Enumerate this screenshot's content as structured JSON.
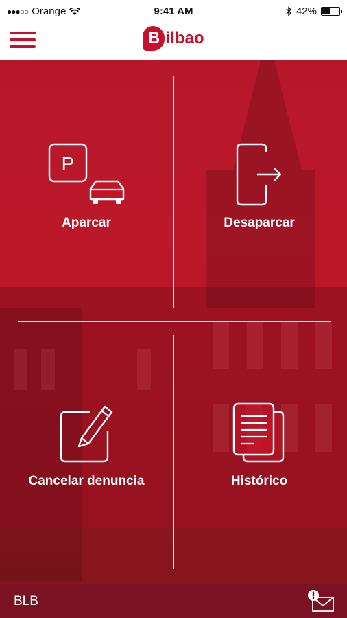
{
  "status_bar": {
    "carrier": "Orange",
    "time": "9:41 AM",
    "battery": "42%",
    "battery_level": 0.42
  },
  "header": {
    "logo_initial": "B",
    "logo_text": "ilbao"
  },
  "tiles": [
    {
      "label": "Aparcar",
      "icon": "parking-car-icon"
    },
    {
      "label": "Desaparcar",
      "icon": "phone-exit-icon"
    },
    {
      "label": "Cancelar denuncia",
      "icon": "edit-pencil-icon"
    },
    {
      "label": "Histórico",
      "icon": "documents-icon"
    }
  ],
  "footer": {
    "text": "BLB",
    "mail_icon": "mail-alert-icon"
  },
  "colors": {
    "brand": "#c8102e",
    "footer": "#7a1224"
  }
}
